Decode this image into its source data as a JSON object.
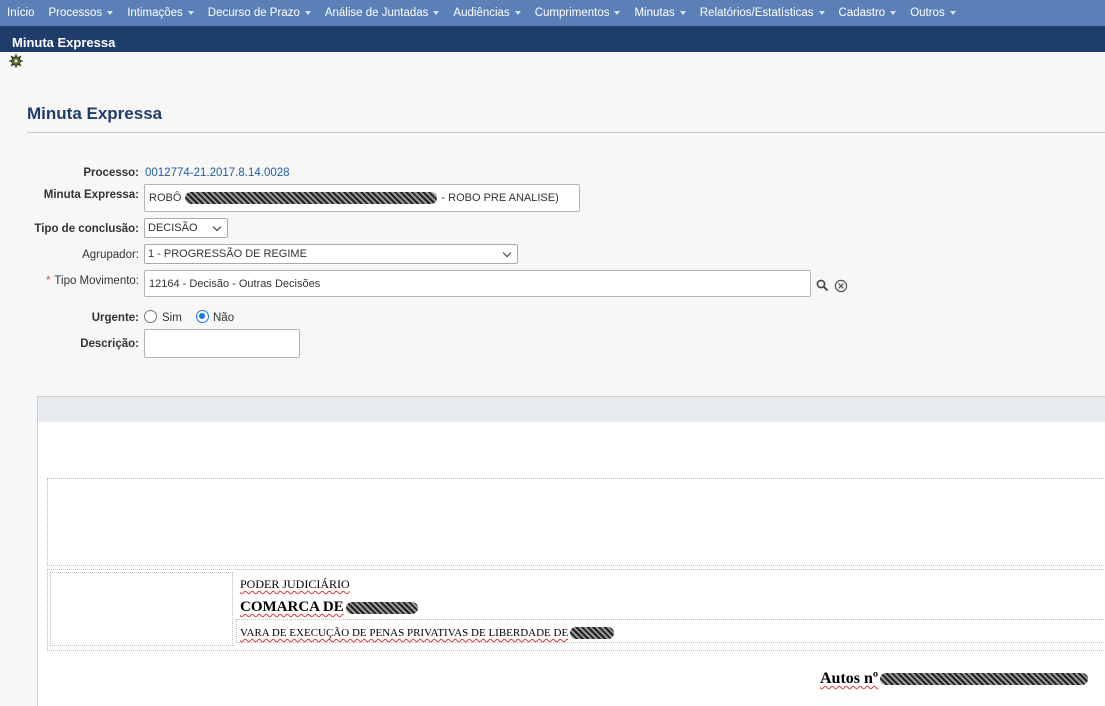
{
  "nav": {
    "items": [
      {
        "label": "Início",
        "dropdown": false
      },
      {
        "label": "Processos",
        "dropdown": true
      },
      {
        "label": "Intimações",
        "dropdown": true
      },
      {
        "label": "Decurso de Prazo",
        "dropdown": true
      },
      {
        "label": "Análise de Juntadas",
        "dropdown": true
      },
      {
        "label": "Audiências",
        "dropdown": true
      },
      {
        "label": "Cumprimentos",
        "dropdown": true
      },
      {
        "label": "Minutas",
        "dropdown": true
      },
      {
        "label": "Relatórios/Estatísticas",
        "dropdown": true
      },
      {
        "label": "Cadastro",
        "dropdown": true
      },
      {
        "label": "Outros",
        "dropdown": true
      }
    ]
  },
  "titlebar": {
    "title": "Minuta Expressa"
  },
  "page": {
    "heading": "Minuta Expressa"
  },
  "form": {
    "processo_label": "Processo:",
    "processo_value": "0012774-21.2017.8.14.0028",
    "minuta_label": "Minuta Expressa:",
    "minuta_prefix": "ROBÔ",
    "minuta_suffix": "- ROBO PRE ANALISE)",
    "tipo_conclusao_label": "Tipo de conclusão:",
    "tipo_conclusao_value": "DECISÃO",
    "agrupador_label": "Agrupador:",
    "agrupador_value": "1 - PROGRESSÃO DE REGIME",
    "tipo_movimento_required": "*",
    "tipo_movimento_label": "Tipo Movimento:",
    "tipo_movimento_value": "12164 - Decisão - Outras Decisões",
    "urgente_label": "Urgente:",
    "urgente_sim": "Sim",
    "urgente_nao": "Não",
    "urgente_selected": "Não",
    "descricao_label": "Descrição:",
    "descricao_value": ""
  },
  "document": {
    "line1": "PODER JUDICIÁRIO",
    "line2": "COMARCA DE",
    "line3": "VARA DE EXECUÇÃO DE PENAS PRIVATIVAS DE LIBERDADE DE",
    "autos_label": "Autos nº"
  },
  "icons": {
    "gear": "gear-icon",
    "search": "search-icon",
    "clear": "clear-icon"
  }
}
